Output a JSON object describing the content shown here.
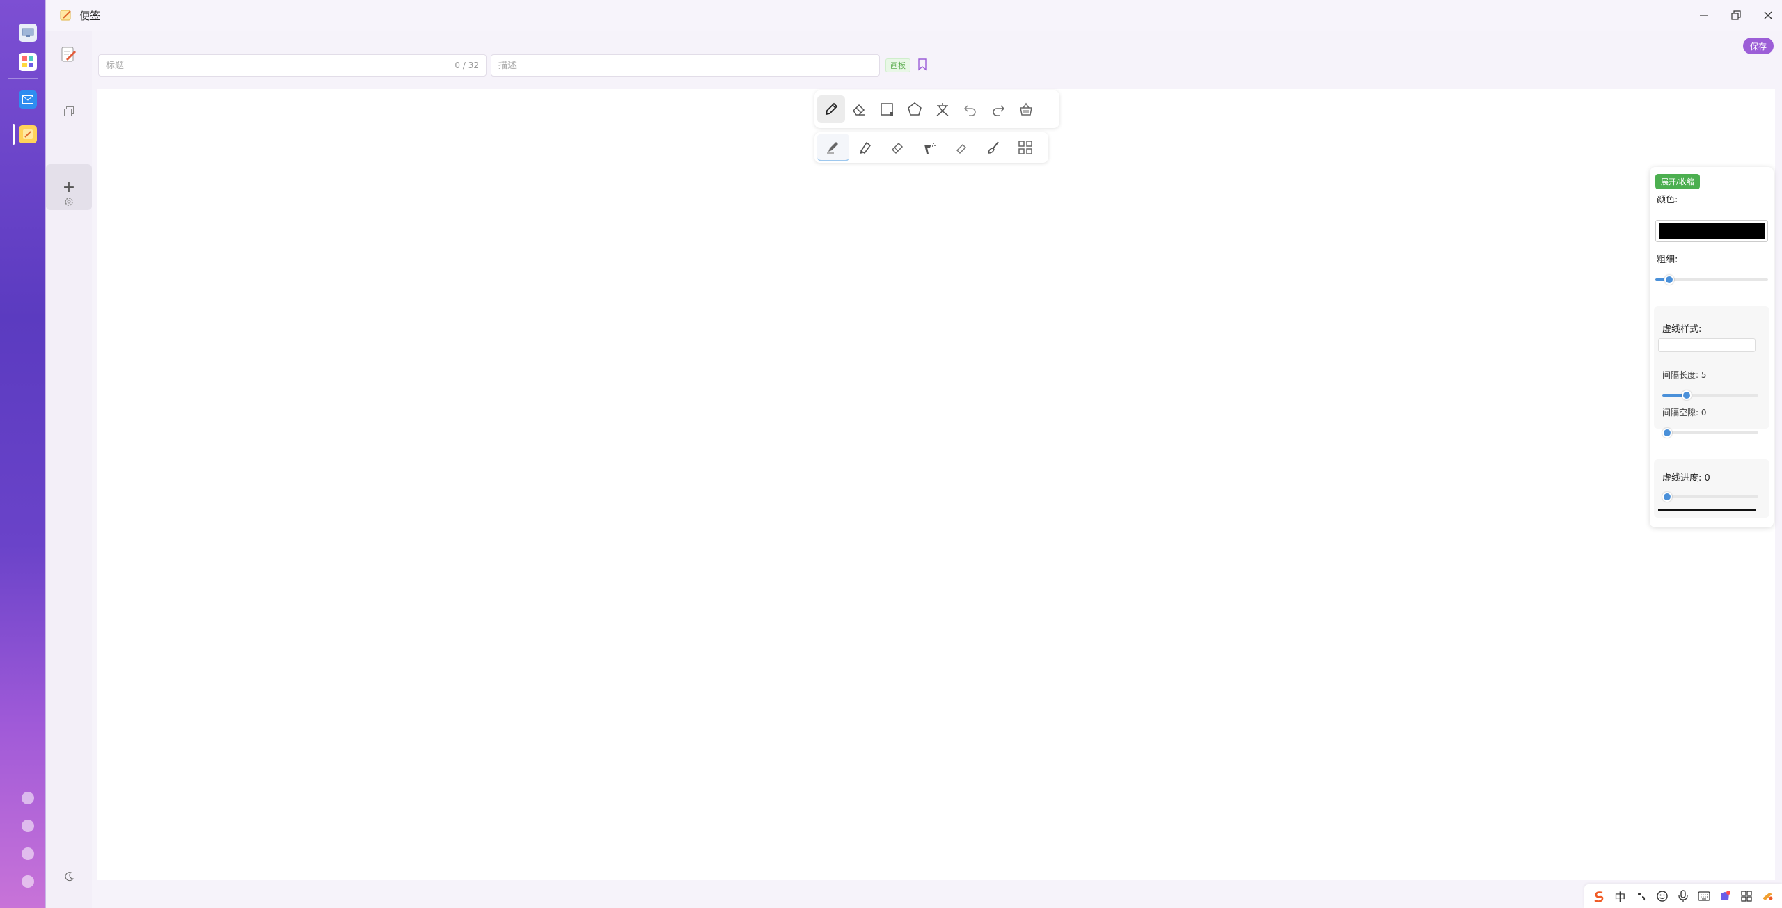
{
  "window": {
    "title": "便签",
    "controls": {
      "minimize": "minimize-icon",
      "maximize": "restore-icon",
      "close": "close-icon"
    }
  },
  "header": {
    "title_placeholder": "标题",
    "title_count": "0 / 32",
    "desc_placeholder": "描述",
    "mode_tag": "画板",
    "save_label": "保存"
  },
  "sidebar": {
    "items": [
      {
        "icon": "note-edit-icon"
      },
      {
        "icon": "copy-icon"
      },
      {
        "icon": "plus-icon",
        "label": "+"
      },
      {
        "icon": "gear-icon"
      },
      {
        "icon": "moon-icon"
      }
    ]
  },
  "toolbar_main": {
    "tools": [
      "pencil-icon",
      "eraser-icon",
      "rectangle-icon",
      "pentagon-icon",
      "text-icon",
      "undo-icon",
      "redo-icon",
      "clear-basket-icon"
    ],
    "active": 0
  },
  "toolbar_brush": {
    "brushes": [
      "pen-brush-icon",
      "marker-brush-icon",
      "crayon-brush-icon",
      "spray-brush-icon",
      "chalk-brush-icon",
      "paint-brush-icon",
      "pattern-brush-icon"
    ],
    "active": 0
  },
  "panel": {
    "toggle_label": "展开/收缩",
    "color_label": "颜色:",
    "color_value": "#000000",
    "width_label": "粗细:",
    "width_value": 0.08,
    "dash_style_label": "虚线样式:",
    "dash_length_label": "间隔长度: 5",
    "dash_length_value": 0.2,
    "dash_gap_label": "间隔空隙: 0",
    "dash_gap_value": 0,
    "dash_progress_label": "虚线进度: 0",
    "dash_progress_value": 0
  },
  "tray": {
    "items": [
      "sogou-icon",
      "中",
      "punctuation-icon",
      "emoji-icon",
      "microphone-icon",
      "keyboard-icon",
      "skin-icon",
      "grid-icon",
      "tools-icon"
    ]
  },
  "colors": {
    "accent": "#9c5ed7",
    "green": "#4caf50",
    "slider": "#4a90d9"
  }
}
